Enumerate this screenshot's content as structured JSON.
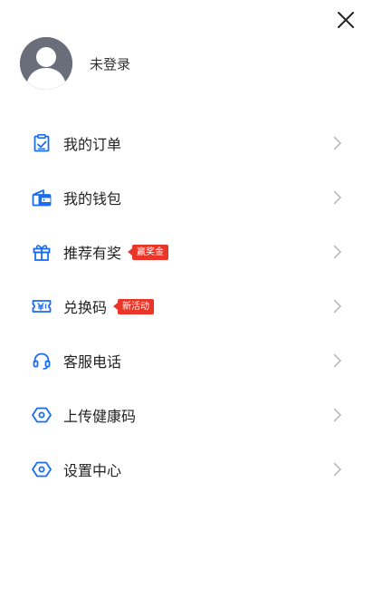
{
  "header": {
    "close_icon": "close-icon"
  },
  "profile": {
    "avatar_icon": "default-avatar-icon",
    "login_status": "未登录"
  },
  "colors": {
    "accent": "#1a6cf0",
    "badge": "#e93628",
    "chevron": "#b3b3b3",
    "avatar_bg": "#6a6e7b"
  },
  "menu": {
    "items": [
      {
        "label": "我的订单",
        "icon": "order-clipboard-icon",
        "badge": ""
      },
      {
        "label": "我的钱包",
        "icon": "wallet-icon",
        "badge": ""
      },
      {
        "label": "推荐有奖",
        "icon": "gift-icon",
        "badge": "赢奖金"
      },
      {
        "label": "兑换码",
        "icon": "redeem-code-icon",
        "badge": "新活动"
      },
      {
        "label": "客服电话",
        "icon": "headset-icon",
        "badge": ""
      },
      {
        "label": "上传健康码",
        "icon": "hexagon-icon",
        "badge": ""
      },
      {
        "label": "设置中心",
        "icon": "settings-hexagon-icon",
        "badge": ""
      }
    ]
  }
}
